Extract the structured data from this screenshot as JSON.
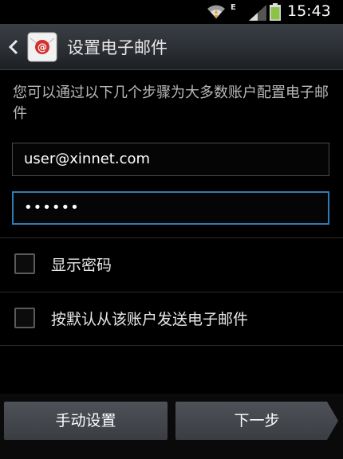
{
  "status_bar": {
    "network_type": "E",
    "time": "15:43"
  },
  "header": {
    "title": "设置电子邮件"
  },
  "instruction": "您可以通过以下几个步骤为大多数账户配置电子邮件",
  "form": {
    "email_value": "user@xinnet.com",
    "password_value": "••••••"
  },
  "options": [
    {
      "label": "显示密码",
      "checked": false
    },
    {
      "label": "按默认从该账户发送电子邮件",
      "checked": false
    }
  ],
  "buttons": {
    "manual_setup": "手动设置",
    "next": "下一步"
  },
  "colors": {
    "focus_border": "#2f7cb3",
    "battery": "#8bc34a"
  }
}
